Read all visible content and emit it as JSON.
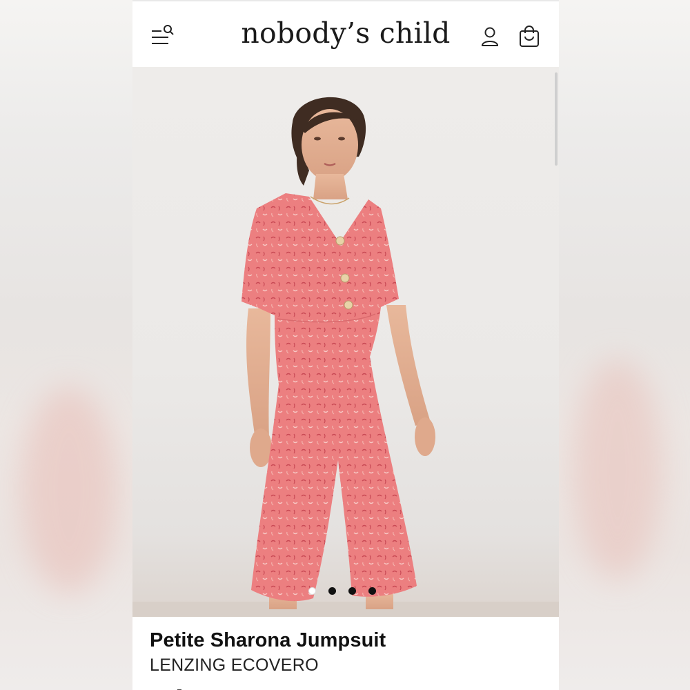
{
  "header": {
    "brand": "nobody’s child",
    "icons": {
      "menu_search": "menu-search-icon",
      "account": "user-icon",
      "cart": "shopping-bag-icon"
    }
  },
  "gallery": {
    "image_count": 4,
    "active_index": 0
  },
  "product": {
    "name": "Petite Sharona Jumpsuit",
    "fabric": "LENZING ECOVERO"
  },
  "colors": {
    "jumpsuit": "#e8787a",
    "background": "#eeecea",
    "text": "#111111"
  }
}
